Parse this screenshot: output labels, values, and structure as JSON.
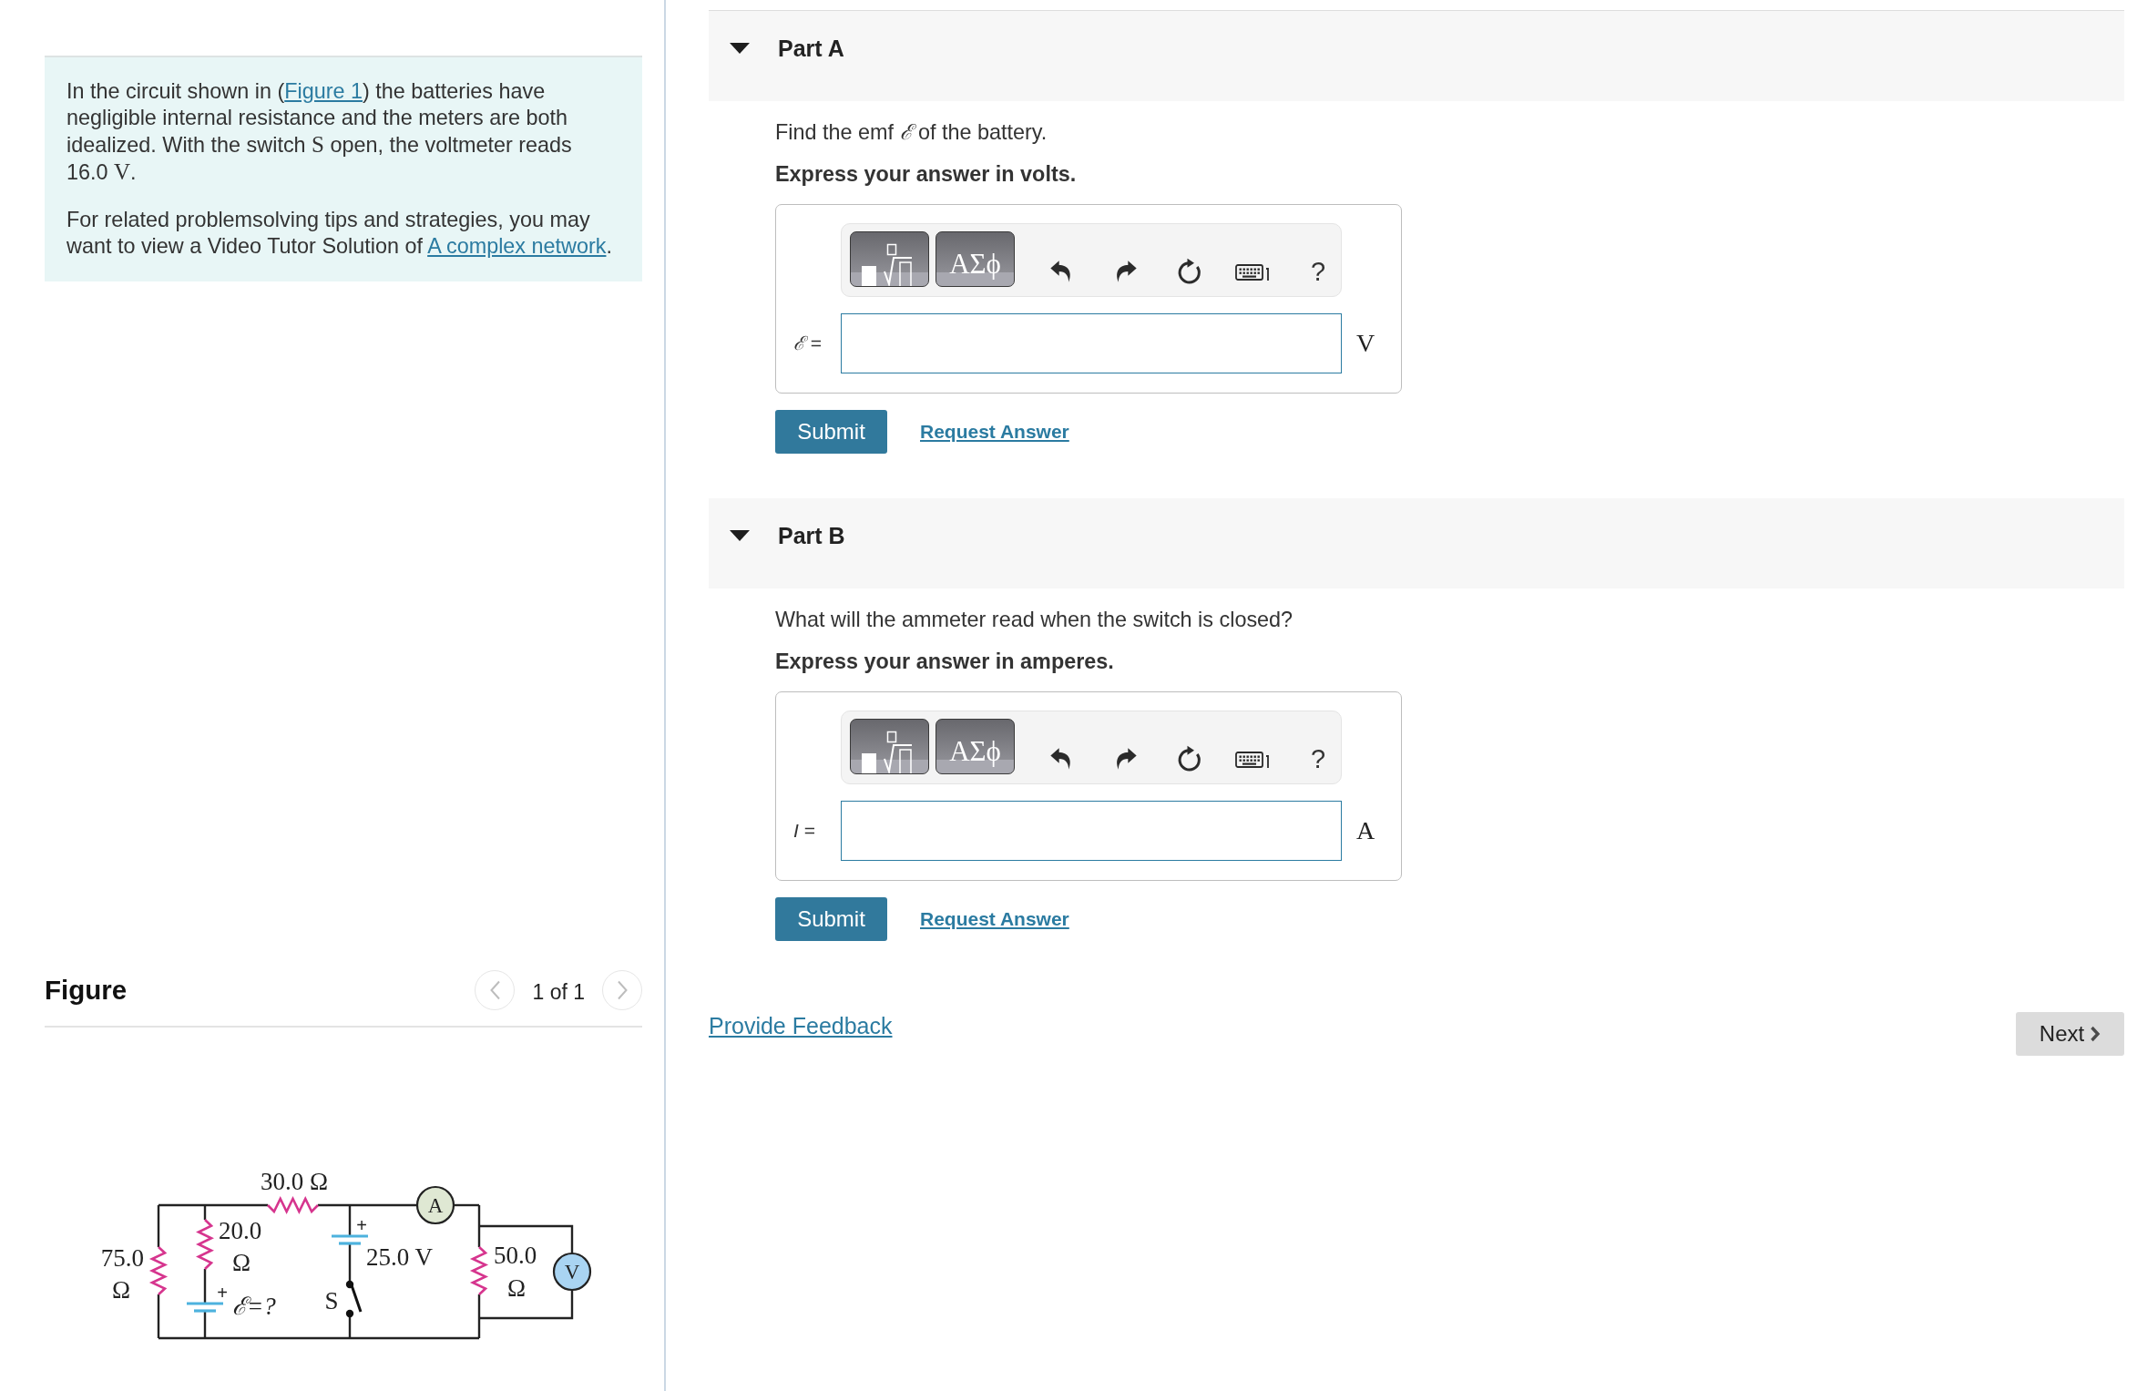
{
  "problem": {
    "paragraphs": [
      {
        "segments": [
          {
            "kind": "text",
            "text": "In the circuit shown in ("
          },
          {
            "kind": "link",
            "text": "Figure 1"
          },
          {
            "kind": "text",
            "text": ") the batteries have negligible internal resistance and the meters are both idealized. With the switch "
          },
          {
            "kind": "math",
            "text": "S"
          },
          {
            "kind": "text",
            "text": " open, the voltmeter reads 16.0 "
          },
          {
            "kind": "math",
            "text": "V"
          },
          {
            "kind": "text",
            "text": "."
          }
        ]
      },
      {
        "segments": [
          {
            "kind": "text",
            "text": "For related problemsolving tips and strategies, you may want to view a Video Tutor Solution of "
          },
          {
            "kind": "link",
            "text": "A complex network"
          },
          {
            "kind": "text",
            "text": "."
          }
        ]
      }
    ]
  },
  "figure": {
    "title": "Figure",
    "pager": {
      "label": "1 of 1",
      "prev": {
        "disabled": true
      },
      "next": {
        "disabled": true
      }
    },
    "circuit": {
      "resistors": [
        {
          "label": "30.0 Ω"
        },
        {
          "label": "20.0 Ω"
        },
        {
          "label": "75.0 Ω"
        },
        {
          "label": "50.0 Ω"
        }
      ],
      "batteries": [
        {
          "label": "25.0 V",
          "sign": "+"
        },
        {
          "label": "ℰ=?",
          "sign": "+"
        }
      ],
      "meters": [
        {
          "label": "A"
        },
        {
          "label": "V"
        }
      ],
      "switch": {
        "label": "S"
      }
    }
  },
  "parts": [
    {
      "title": "Part A",
      "expanded": true,
      "question": "Find the emf *ℰ* of the battery.",
      "instruction": "Express your answer in volts.",
      "toolbar": {
        "symbols": "ΑΣϕ",
        "help": "?"
      },
      "answer": {
        "label": "*ℰ* =",
        "unit": "V"
      },
      "submit": "Submit",
      "request": "Request Answer"
    },
    {
      "title": "Part B",
      "expanded": true,
      "question": "What will the ammeter read when the switch is closed?",
      "instruction": "Express your answer in amperes.",
      "toolbar": {
        "symbols": "ΑΣϕ",
        "help": "?"
      },
      "answer": {
        "label": "*I* =",
        "unit": "A"
      },
      "submit": "Submit",
      "request": "Request Answer"
    }
  ],
  "footer": {
    "feedback": "Provide Feedback",
    "next": "Next"
  }
}
